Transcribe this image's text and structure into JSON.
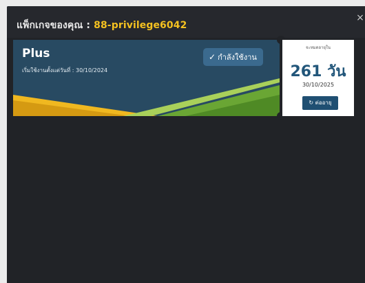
{
  "modal": {
    "title_prefix": "แพ็กเกจของคุณ : ",
    "package_name": "88-privilege6042",
    "close_symbol": "×"
  },
  "ticket": {
    "plan_name": "Plus",
    "start_text": "เริ่มใช้งานตั้งแต่วันที่ : 30/10/2024",
    "status_label": "กำลังใช้งาน",
    "expire_label": "จะหมดอายุใน",
    "days_left": "261 วัน",
    "expire_date": "30/10/2025",
    "renew_label": "ต่ออายุ",
    "check_icon": "✓",
    "renew_icon": "↻"
  },
  "colors": {
    "title_accent": "#f4c120",
    "card_bg": "#284a62",
    "stripe_yellow": "#f0b820",
    "stripe_green": "#6aa634",
    "days_color": "#22567a",
    "modal_bg": "#212327"
  }
}
